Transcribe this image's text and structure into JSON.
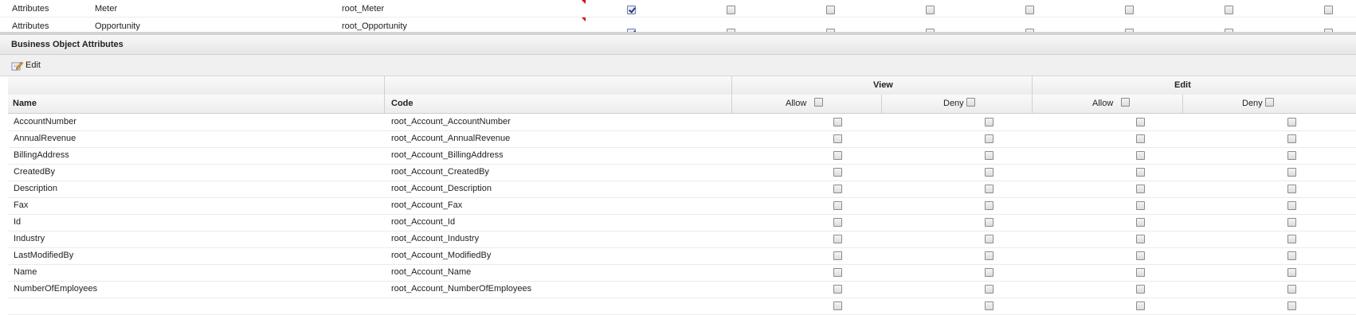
{
  "top_grid": {
    "rows": [
      {
        "type": "Attributes",
        "name": "Meter",
        "code": "root_Meter",
        "checks": [
          true,
          false,
          false,
          false,
          false,
          false,
          false,
          false,
          false
        ]
      },
      {
        "type": "Attributes",
        "name": "Opportunity",
        "code": "root_Opportunity",
        "checks": [
          true,
          false,
          false,
          false,
          false,
          false,
          false,
          false,
          false
        ]
      }
    ]
  },
  "panel": {
    "title": "Business Object Attributes"
  },
  "toolbar": {
    "edit_label": "Edit"
  },
  "grid": {
    "group_view": "View",
    "group_edit": "Edit",
    "col_name": "Name",
    "col_code": "Code",
    "col_allow": "Allow",
    "col_deny": "Deny",
    "rows": [
      {
        "name": "AccountNumber",
        "code": "root_Account_AccountNumber"
      },
      {
        "name": "AnnualRevenue",
        "code": "root_Account_AnnualRevenue"
      },
      {
        "name": "BillingAddress",
        "code": "root_Account_BillingAddress"
      },
      {
        "name": "CreatedBy",
        "code": "root_Account_CreatedBy"
      },
      {
        "name": "Description",
        "code": "root_Account_Description"
      },
      {
        "name": "Fax",
        "code": "root_Account_Fax"
      },
      {
        "name": "Id",
        "code": "root_Account_Id"
      },
      {
        "name": "Industry",
        "code": "root_Account_Industry"
      },
      {
        "name": "LastModifiedBy",
        "code": "root_Account_ModifiedBy"
      },
      {
        "name": "Name",
        "code": "root_Account_Name"
      },
      {
        "name": "NumberOfEmployees",
        "code": "root_Account_NumberOfEmployees"
      },
      {
        "name": "",
        "code": ""
      }
    ]
  },
  "icons": {
    "edit": "edit-pencil-icon",
    "dirty": "dirty-flag-icon"
  },
  "colors": {
    "dirty_flag": "#dd0000",
    "header_bg": "#ececec",
    "checked": "#2a3a7a"
  }
}
